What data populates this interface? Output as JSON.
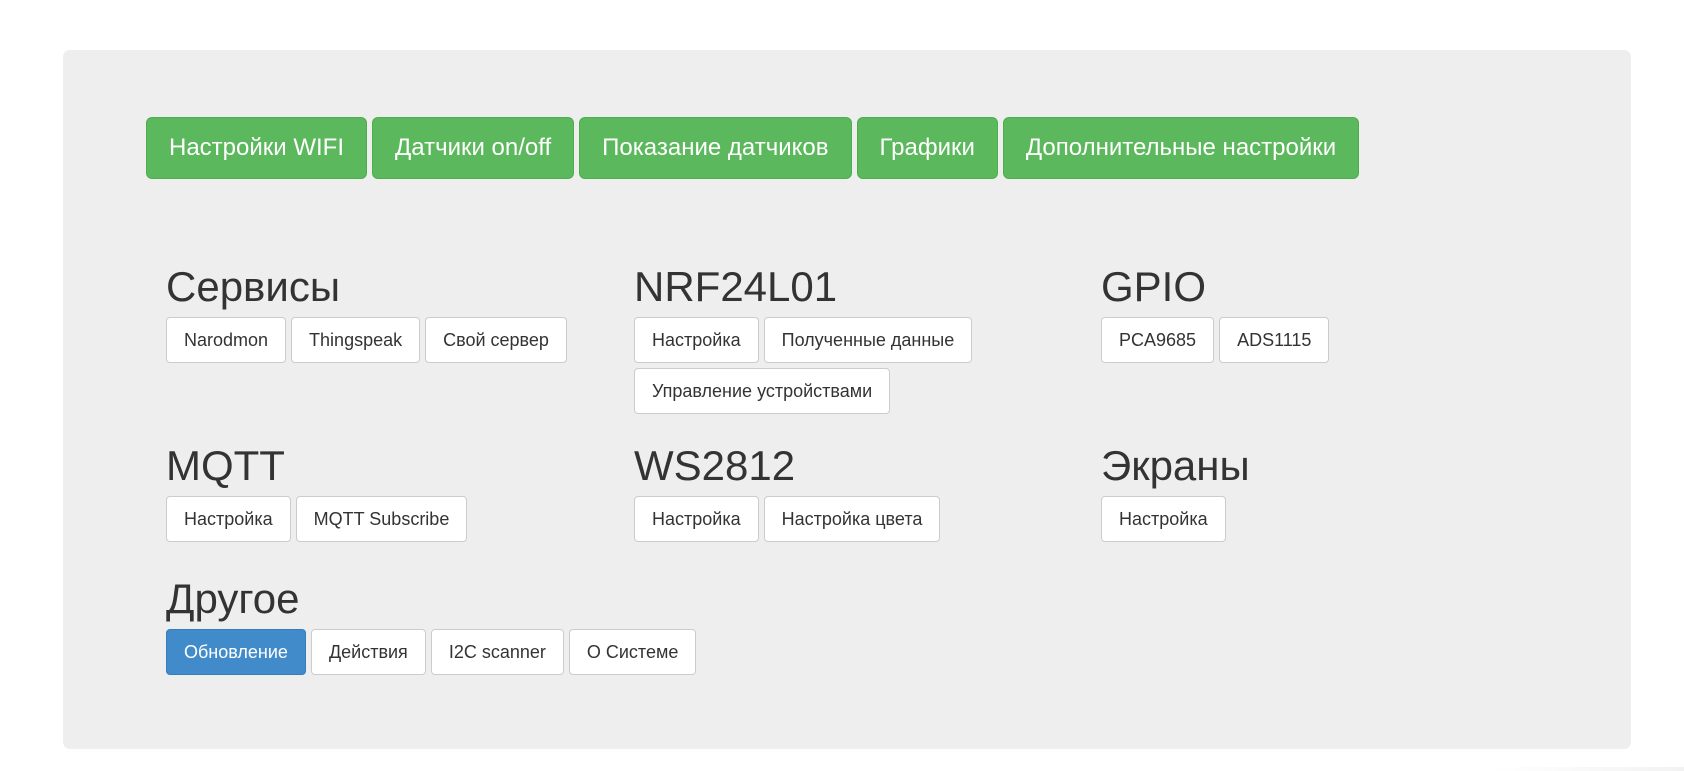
{
  "nav": {
    "buttons": [
      {
        "label": "Настройки WIFI"
      },
      {
        "label": "Датчики on/off"
      },
      {
        "label": "Показание датчиков"
      },
      {
        "label": "Графики"
      },
      {
        "label": "Дополнительные настройки"
      }
    ]
  },
  "sections": {
    "services": {
      "title": "Сервисы",
      "buttons": [
        "Narodmon",
        "Thingspeak",
        "Свой сервер"
      ]
    },
    "nrf": {
      "title": "NRF24L01",
      "buttons": [
        "Настройка",
        "Полученные данные",
        "Управление устройствами"
      ]
    },
    "gpio": {
      "title": "GPIO",
      "buttons": [
        "PCA9685",
        "ADS1115"
      ]
    },
    "mqtt": {
      "title": "MQTT",
      "buttons": [
        "Настройка",
        "MQTT Subscribe"
      ]
    },
    "ws2812": {
      "title": "WS2812",
      "buttons": [
        "Настройка",
        "Настройка цвета"
      ]
    },
    "screens": {
      "title": "Экраны",
      "buttons": [
        "Настройка"
      ]
    },
    "other": {
      "title": "Другое",
      "buttons": [
        "Обновление",
        "Действия",
        "I2C scanner",
        "О Системе"
      ]
    }
  },
  "colors": {
    "panel_bg": "#eeeeee",
    "success": "#5cb85c",
    "primary": "#428bca"
  }
}
